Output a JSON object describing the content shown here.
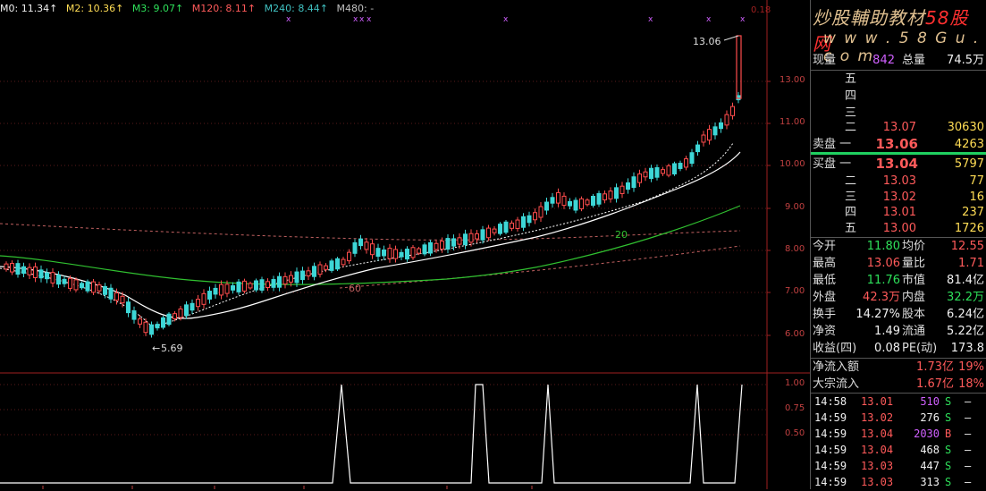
{
  "ma_header": {
    "m0": "M0: 11.34↑",
    "m2": "M2: 10.36↑",
    "m3": "M3: 9.07↑",
    "m120": "M120: 8.11↑",
    "m240": "M240: 8.44↑",
    "m480": "M480: -"
  },
  "price_axis": [
    "13.00",
    "11.00",
    "10.00",
    "9.00",
    "8.00",
    "7.00",
    "6.00"
  ],
  "indicator_axis": [
    "1.00",
    "0.75",
    "0.50"
  ],
  "chart_labels": {
    "high": "13.06",
    "low": "5.69",
    "ma_20": "20",
    "ma_60": "60",
    "top_right_mark": "0.18"
  },
  "colors": {
    "up": "#ff4d4d",
    "down": "#3dd6d6",
    "ma_white": "#ffffff",
    "ma_green": "#30c030",
    "accent_red": "#ff3030"
  },
  "brand": {
    "line1a": "炒股輔助教材",
    "line1b": "58股网",
    "line2": "w w w . 5 8 G u . c o m"
  },
  "quote": {
    "xianliang_label": "现量",
    "xianliang": "842",
    "zongliang_label": "总量",
    "zongliang": "74.5万",
    "sell": [
      {
        "label": "五",
        "price": "",
        "vol": ""
      },
      {
        "label": "四",
        "price": "",
        "vol": ""
      },
      {
        "label": "三",
        "price": "",
        "vol": ""
      },
      {
        "label": "二",
        "price": "13.07",
        "vol": "30630"
      },
      {
        "label": "卖盘 一",
        "price": "13.06",
        "vol": "4263"
      }
    ],
    "buy": [
      {
        "label": "买盘 一",
        "price": "13.04",
        "vol": "5797"
      },
      {
        "label": "二",
        "price": "13.03",
        "vol": "77"
      },
      {
        "label": "三",
        "price": "13.02",
        "vol": "16"
      },
      {
        "label": "四",
        "price": "13.01",
        "vol": "237"
      },
      {
        "label": "五",
        "price": "13.00",
        "vol": "1726"
      }
    ]
  },
  "stats": [
    {
      "l1": "今开",
      "v1": "11.80",
      "c1": "green",
      "l2": "均价",
      "v2": "12.55",
      "c2": "red"
    },
    {
      "l1": "最高",
      "v1": "13.06",
      "c1": "red",
      "l2": "量比",
      "v2": "1.71",
      "c2": "red"
    },
    {
      "l1": "最低",
      "v1": "11.76",
      "c1": "green",
      "l2": "市值",
      "v2": "81.4亿",
      "c2": "white"
    },
    {
      "l1": "外盘",
      "v1": "42.3万",
      "c1": "red",
      "l2": "内盘",
      "v2": "32.2万",
      "c2": "green"
    },
    {
      "l1": "换手",
      "v1": "14.27%",
      "c1": "white",
      "l2": "股本",
      "v2": "6.24亿",
      "c2": "white"
    },
    {
      "l1": "净资",
      "v1": "1.49",
      "c1": "white",
      "l2": "流通",
      "v2": "5.22亿",
      "c2": "white"
    },
    {
      "l1": "收益(四)",
      "v1": "0.08",
      "c1": "white",
      "l2": "PE(动)",
      "v2": "173.8",
      "c2": "white"
    }
  ],
  "flows": [
    {
      "label": "净流入额",
      "amount": "1.73亿",
      "pct": "19%"
    },
    {
      "label": "大宗流入",
      "amount": "1.67亿",
      "pct": "18%"
    }
  ],
  "trades": [
    {
      "time": "14:58",
      "price": "13.01",
      "vol": "510",
      "vc": "purple",
      "side": "S",
      "sc": "green",
      "dash": "—"
    },
    {
      "time": "14:59",
      "price": "13.02",
      "vol": "276",
      "vc": "white",
      "side": "S",
      "sc": "green",
      "dash": "—"
    },
    {
      "time": "14:59",
      "price": "13.04",
      "vol": "2030",
      "vc": "purple",
      "side": "B",
      "sc": "red",
      "dash": "—"
    },
    {
      "time": "14:59",
      "price": "13.04",
      "vol": "468",
      "vc": "white",
      "side": "S",
      "sc": "green",
      "dash": "—"
    },
    {
      "time": "14:59",
      "price": "13.03",
      "vol": "447",
      "vc": "white",
      "side": "S",
      "sc": "green",
      "dash": "—"
    },
    {
      "time": "14:59",
      "price": "13.03",
      "vol": "313",
      "vc": "white",
      "side": "S",
      "sc": "green",
      "dash": "—"
    }
  ]
}
